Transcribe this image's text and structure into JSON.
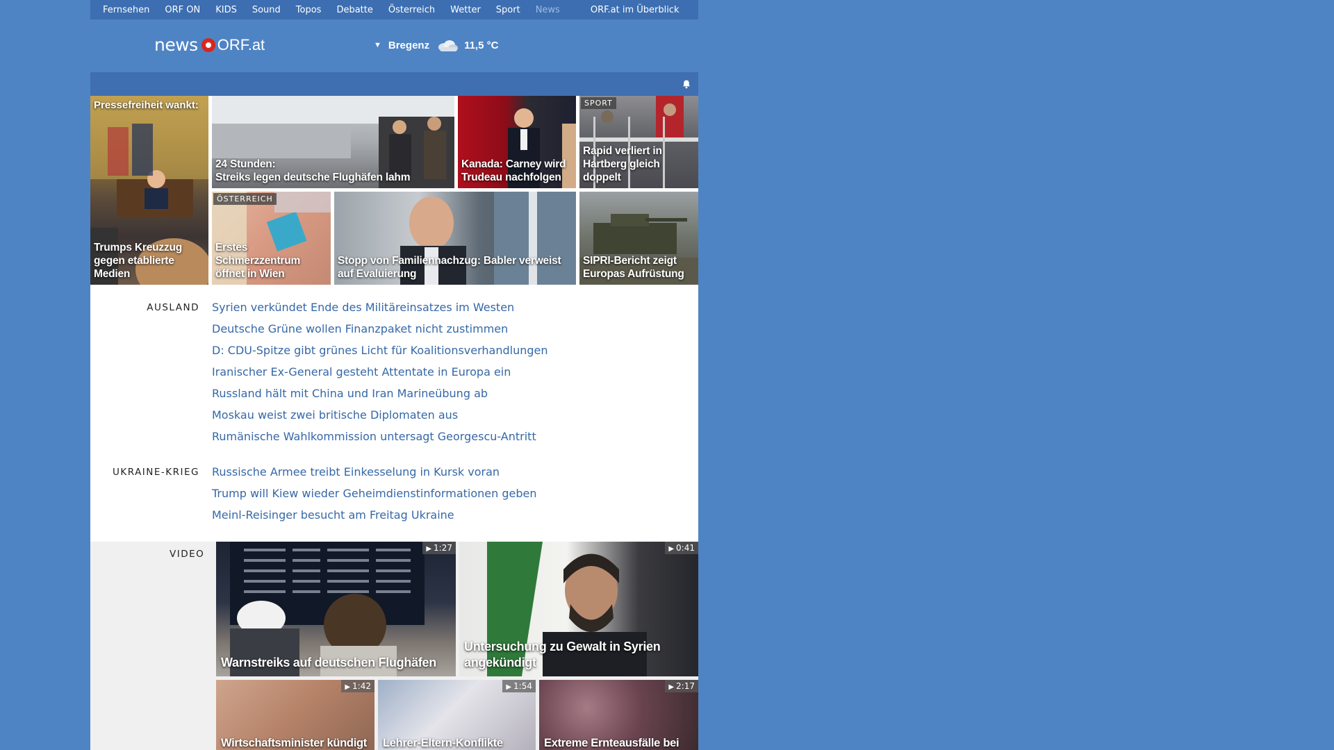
{
  "topnav": [
    "Fernsehen",
    "ORF ON",
    "KIDS",
    "Sound",
    "Topos",
    "Debatte",
    "Österreich",
    "Wetter",
    "Sport",
    "News",
    "ORF.at im Überblick"
  ],
  "header": {
    "logo_news": "news",
    "logo_orf": "ORF.at",
    "city": "Bregenz",
    "temperature": "11,5 °C",
    "weather_icon": "cloud-icon"
  },
  "colors": {
    "page_bg": "#4f84c4",
    "link": "#3568a8",
    "orf_red": "#d9261c"
  },
  "teasers": {
    "pressefreiheit_top": "Pressefreiheit wankt:",
    "trump": "Trumps Kreuzzug gegen etablierte Medien",
    "streik_line1": "24 Stunden:",
    "streik_line2": "Streiks legen deutsche Flughäfen lahm",
    "kanada": "Kanada: Carney wird Trudeau nachfolgen",
    "sport_tag": "SPORT",
    "rapid": "Rapid verliert in Hartberg gleich doppelt",
    "oesterreich_tag": "ÖSTERREICH",
    "schmerz": "Erstes Schmerzzentrum öffnet in Wien",
    "familie": "Stopp von Familiennachzug: Babler verweist auf Evaluierung",
    "sipri": "SIPRI-Bericht zeigt Europas Aufrüstung"
  },
  "sections": [
    {
      "label": "AUSLAND",
      "items": [
        "Syrien verkündet Ende des Militäreinsatzes im Westen",
        "Deutsche Grüne wollen Finanzpaket nicht zustimmen",
        "D: CDU-Spitze gibt grünes Licht für Koalitionsverhandlungen",
        "Iranischer Ex-General gesteht Attentate in Europa ein",
        "Russland hält mit China und Iran Marineübung ab",
        "Moskau weist zwei britische Diplomaten aus",
        "Rumänische Wahlkommission untersagt Georgescu-Antritt"
      ]
    },
    {
      "label": "UKRAINE-KRIEG",
      "items": [
        "Russische Armee treibt Einkesselung in Kursk voran",
        "Trump will Kiew wieder Geheimdienstinformationen geben",
        "Meinl-Reisinger besucht am Freitag Ukraine"
      ]
    }
  ],
  "video": {
    "label": "VIDEO",
    "items": [
      {
        "title": "Warnstreiks auf deutschen Flughäfen",
        "duration": "1:27"
      },
      {
        "title": "Untersuchung zu Gewalt in Syrien angekündigt",
        "duration": "0:41"
      },
      {
        "title": "Wirtschaftsminister kündigt",
        "duration": "1:42"
      },
      {
        "title": "Lehrer-Eltern-Konflikte",
        "duration": "1:54"
      },
      {
        "title": "Extreme Ernteausfälle bei",
        "duration": "2:17"
      }
    ]
  }
}
